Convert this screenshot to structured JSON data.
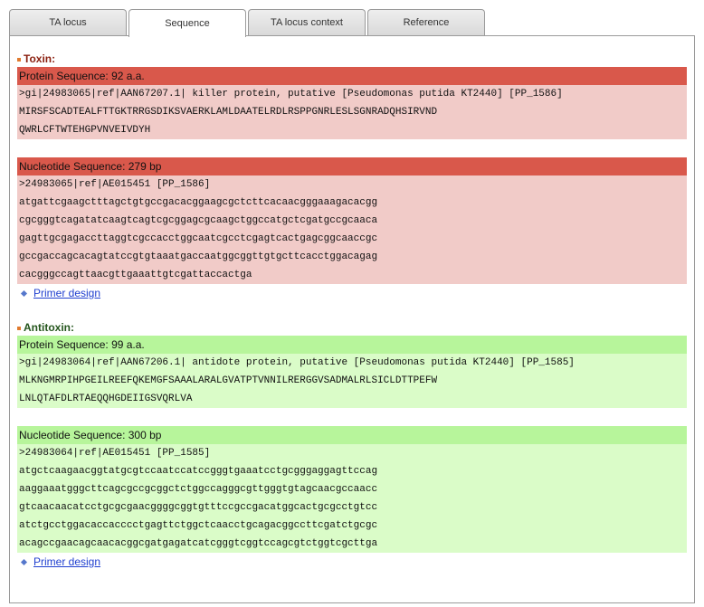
{
  "tabs": [
    {
      "label": "TA locus"
    },
    {
      "label": "Sequence"
    },
    {
      "label": "TA locus context"
    },
    {
      "label": "Reference"
    }
  ],
  "toxin": {
    "title": "Toxin:",
    "protein": {
      "header": "Protein Sequence: 92 a.a.",
      "lines": [
        ">gi|24983065|ref|AAN67207.1| killer protein, putative [Pseudomonas putida KT2440] [PP_1586]",
        "MIRSFSCADTEALFTTGKTRRGSDIKSVAERKLAMLDAATELRDLRSPPGNRLESLSGNRADQHSIRVND",
        "QWRLCFTWTEHGPVNVEIVDYH"
      ]
    },
    "nucleotide": {
      "header": "Nucleotide Sequence: 279 bp",
      "lines": [
        ">24983065|ref|AE015451 [PP_1586]",
        "atgattcgaagctttagctgtgccgacacggaagcgctcttcacaacgggaaagacacgg",
        "cgcgggtcagatatcaagtcagtcgcggagcgcaagctggccatgctcgatgccgcaaca",
        "gagttgcgagaccttaggtcgccacctggcaatcgcctcgagtcactgagcggcaaccgc",
        "gccgaccagcacagtatccgtgtaaatgaccaatggcggttgtgcttcacctggacagag",
        "cacgggccagttaacgttgaaattgtcgattaccactga"
      ]
    },
    "primer_link": "Primer design"
  },
  "antitoxin": {
    "title": "Antitoxin:",
    "protein": {
      "header": "Protein Sequence: 99 a.a.",
      "lines": [
        ">gi|24983064|ref|AAN67206.1| antidote protein, putative [Pseudomonas putida KT2440] [PP_1585]",
        "MLKNGMRPIHPGEILREEFQKEMGFSAAALARALGVATPTVNNILRERGGVSADMALRLSICLDTTPEFW",
        "LNLQTAFDLRTAEQQHGDEIIGSVQRLVA"
      ]
    },
    "nucleotide": {
      "header": "Nucleotide Sequence: 300 bp",
      "lines": [
        ">24983064|ref|AE015451 [PP_1585]",
        "atgctcaagaacggtatgcgtccaatccatccgggtgaaatcctgcgggaggagttccag",
        "aaggaaatgggcttcagcgccgcggctctggccagggcgttgggtgtagcaacgccaacc",
        "gtcaacaacatcctgcgcgaacggggcggtgtttccgccgacatggcactgcgcctgtcc",
        "atctgcctggacaccacccctgagttctggctcaacctgcagacggccttcgatctgcgc",
        "acagccgaacagcaacacggcgatgagatcatcgggtcggtccagcgtctggtcgcttga"
      ]
    },
    "primer_link": "Primer design"
  },
  "colors": {
    "toxin_bar": "#d9584b",
    "toxin_box": "#f1cbc8",
    "antitoxin_bar": "#b7f59b",
    "antitoxin_box": "#dafcc8",
    "link": "#1f3fcf"
  }
}
